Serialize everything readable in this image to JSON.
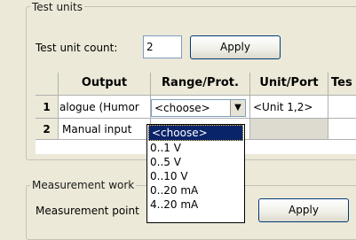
{
  "test_units": {
    "legend": "Test units",
    "count_label": "Test unit count:",
    "count_value": "2",
    "apply_label": "Apply"
  },
  "grid": {
    "headers": [
      "",
      "Output",
      "Range/Prot.",
      "Unit/Port",
      "Tes"
    ],
    "rows": [
      {
        "num": "1",
        "output": "alogue (Humor",
        "range": "<choose>",
        "unit": "<Unit 1,2>"
      },
      {
        "num": "2",
        "output": "Manual input"
      }
    ]
  },
  "dropdown": {
    "options": [
      "<choose>",
      "0..1 V",
      "0..5 V",
      "0..10 V",
      "0..20 mA",
      "4..20 mA"
    ],
    "selected_index": 0
  },
  "measurement": {
    "legend": "Measurement work",
    "point_label": "Measurement point",
    "apply_label": "Apply"
  }
}
